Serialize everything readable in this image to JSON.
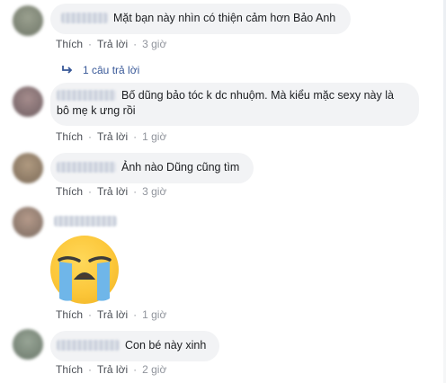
{
  "comments": [
    {
      "text": "Mặt bạn này nhìn có thiện cảm hơn Bảo Anh",
      "actions": {
        "like": "Thích",
        "reply": "Trả lời",
        "time": "3 giờ"
      },
      "replies_link": "1 câu trả lời"
    },
    {
      "text": "Bố dũng bảo tóc k dc nhuộm. Mà kiểu mặc sexy này là bô mẹ k ưng rồi",
      "actions": {
        "like": "Thích",
        "reply": "Trả lời",
        "time": "1 giờ"
      }
    },
    {
      "text": "Ảnh nào Dũng cũng tìm",
      "actions": {
        "like": "Thích",
        "reply": "Trả lời",
        "time": "3 giờ"
      }
    },
    {
      "emoji": "crying-face-sticker",
      "actions": {
        "like": "Thích",
        "reply": "Trả lời",
        "time": "1 giờ"
      }
    },
    {
      "text": "Con bé này xinh",
      "actions": {
        "like": "Thích",
        "reply": "Trả lời",
        "time": "2 giờ"
      }
    }
  ],
  "icons": {
    "reply_arrow": "reply-arrow-icon"
  },
  "colors": {
    "link": "#385898",
    "bubble": "#f2f3f5",
    "meta": "#90949c"
  }
}
